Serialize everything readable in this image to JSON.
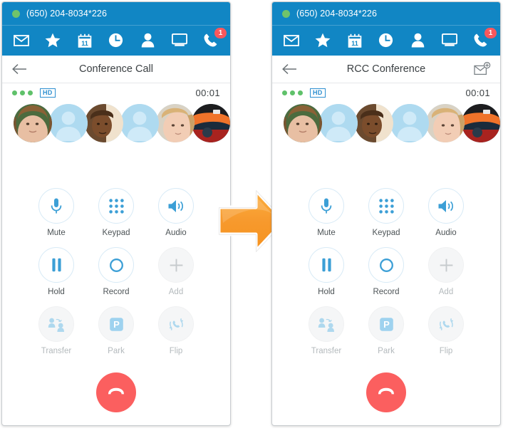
{
  "app": {
    "accent_blue": "#1186c4",
    "status_green": "#5fc16a",
    "badge_red": "#f9575c",
    "end_call_red": "#fb5f5f",
    "icon_blue": "#3c9fd6",
    "arrow_orange": "#f89b2c"
  },
  "account": {
    "status_indicator": "presence-available-dot",
    "number": "(650) 204-8034*226"
  },
  "nav": {
    "items": [
      {
        "name": "messages",
        "icon": "envelope-icon",
        "badge": null
      },
      {
        "name": "favorites",
        "icon": "star-icon",
        "badge": null
      },
      {
        "name": "calendar",
        "icon": "calendar-icon",
        "badge": null,
        "day": "11"
      },
      {
        "name": "history",
        "icon": "clock-icon",
        "badge": null
      },
      {
        "name": "contacts",
        "icon": "person-icon",
        "badge": null
      },
      {
        "name": "meetings",
        "icon": "monitor-icon",
        "badge": null
      },
      {
        "name": "phone",
        "icon": "phone-icon",
        "badge": "1"
      }
    ]
  },
  "panels": [
    {
      "id": "before",
      "title": "Conference Call",
      "back_icon": "back-arrow-icon",
      "invite_icon": null,
      "call": {
        "signal_dots": 3,
        "quality_badge": "HD",
        "timer": "00:01",
        "participant_count": 6,
        "avatars": [
          "photo",
          "placeholder",
          "photo",
          "placeholder",
          "photo",
          "photo"
        ],
        "participants_overlay": "participants-icon"
      }
    },
    {
      "id": "after",
      "title": "RCC Conference",
      "back_icon": "back-arrow-icon",
      "invite_icon": "invite-envelope-plus-icon",
      "call": {
        "signal_dots": 3,
        "quality_badge": "HD",
        "timer": "00:01",
        "participant_count": 6,
        "avatars": [
          "photo",
          "placeholder",
          "photo",
          "placeholder",
          "photo",
          "photo"
        ],
        "participants_overlay": null
      }
    }
  ],
  "actions": [
    {
      "label": "Mute",
      "icon": "microphone-icon",
      "state": "enabled"
    },
    {
      "label": "Keypad",
      "icon": "dialpad-icon",
      "state": "enabled"
    },
    {
      "label": "Audio",
      "icon": "speaker-icon",
      "state": "enabled"
    },
    {
      "label": "Hold",
      "icon": "pause-icon",
      "state": "enabled"
    },
    {
      "label": "Record",
      "icon": "record-circle-icon",
      "state": "enabled"
    },
    {
      "label": "Add",
      "icon": "plus-icon",
      "state": "disabled"
    },
    {
      "label": "Transfer",
      "icon": "transfer-users-icon",
      "state": "disabled"
    },
    {
      "label": "Park",
      "icon": "park-p-icon",
      "state": "disabled"
    },
    {
      "label": "Flip",
      "icon": "flip-phone-icon",
      "state": "disabled"
    }
  ],
  "end_call": {
    "label": "",
    "icon": "hangup-handset-icon"
  },
  "transition": {
    "icon": "right-arrow-icon"
  }
}
